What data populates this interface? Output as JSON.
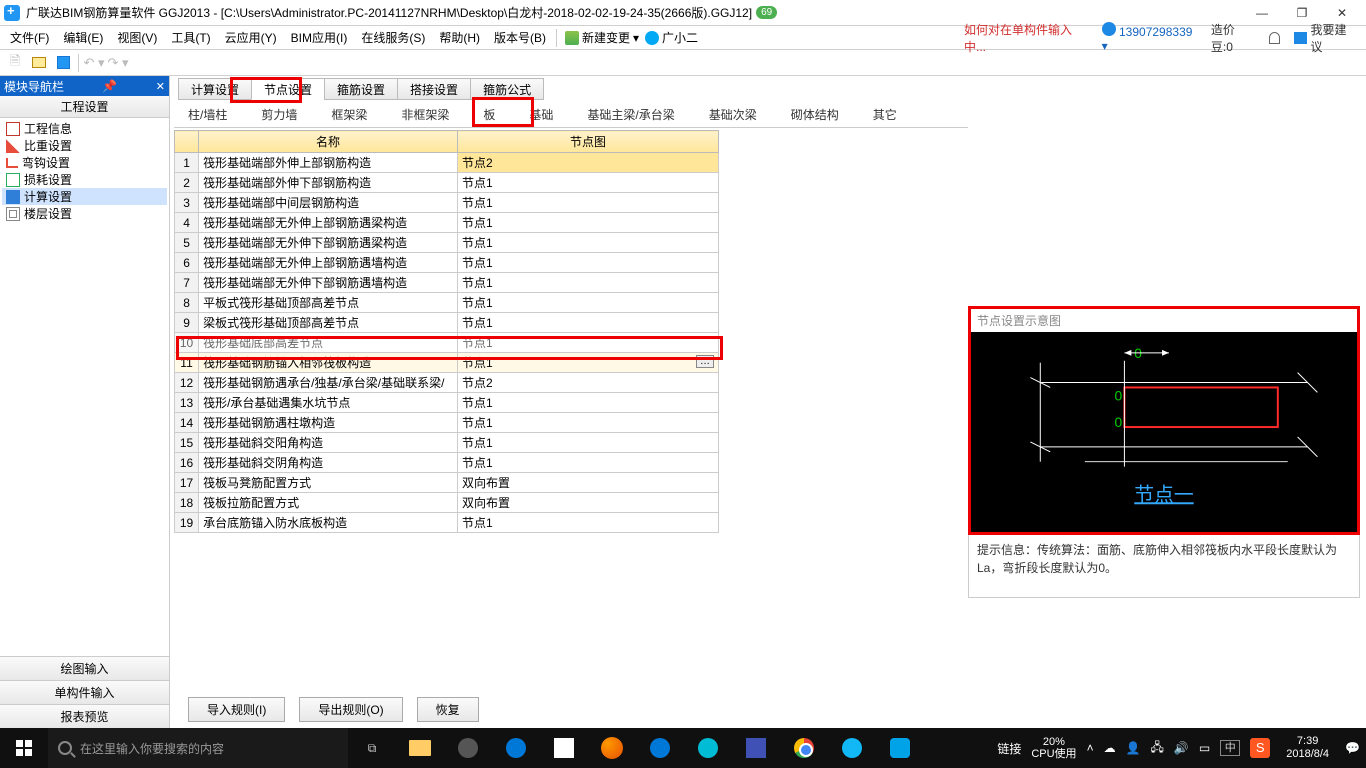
{
  "titlebar": {
    "app": "广联达BIM钢筋算量软件 GGJ2013",
    "doc": "[C:\\Users\\Administrator.PC-20141127NRHM\\Desktop\\白龙村-2018-02-02-19-24-35(2666版).GGJ12]",
    "tag": "69"
  },
  "menu": {
    "items": [
      "文件(F)",
      "编辑(E)",
      "视图(V)",
      "工具(T)",
      "云应用(Y)",
      "BIM应用(I)",
      "在线服务(S)",
      "帮助(H)",
      "版本号(B)"
    ],
    "newchange": "新建变更",
    "gxe": "广小二",
    "hint": "如何对在单构件输入中...",
    "user": "13907298339",
    "bean": "造价豆:0",
    "feedback": "我要建议"
  },
  "nav": {
    "header": "模块导航栏",
    "section": "工程设置",
    "tree": [
      "工程信息",
      "比重设置",
      "弯钩设置",
      "损耗设置",
      "计算设置",
      "楼层设置"
    ],
    "tree_selected_index": 4,
    "bottom": [
      "绘图输入",
      "单构件输入",
      "报表预览"
    ]
  },
  "tabs1": [
    "计算设置",
    "节点设置",
    "箍筋设置",
    "搭接设置",
    "箍筋公式"
  ],
  "tabs1_active": 1,
  "tabs2": [
    "柱/墙柱",
    "剪力墙",
    "框架梁",
    "非框架梁",
    "板",
    "基础",
    "基础主梁/承台梁",
    "基础次梁",
    "砌体结构",
    "其它"
  ],
  "tabs2_active": 5,
  "table": {
    "headers": [
      "",
      "名称",
      "节点图"
    ],
    "rows": [
      {
        "n": 1,
        "name": "筏形基础端部外伸上部钢筋构造",
        "node": "节点2",
        "hl": true
      },
      {
        "n": 2,
        "name": "筏形基础端部外伸下部钢筋构造",
        "node": "节点1"
      },
      {
        "n": 3,
        "name": "筏形基础端部中间层钢筋构造",
        "node": "节点1"
      },
      {
        "n": 4,
        "name": "筏形基础端部无外伸上部钢筋遇梁构造",
        "node": "节点1"
      },
      {
        "n": 5,
        "name": "筏形基础端部无外伸下部钢筋遇梁构造",
        "node": "节点1"
      },
      {
        "n": 6,
        "name": "筏形基础端部无外伸上部钢筋遇墙构造",
        "node": "节点1"
      },
      {
        "n": 7,
        "name": "筏形基础端部无外伸下部钢筋遇墙构造",
        "node": "节点1"
      },
      {
        "n": 8,
        "name": "平板式筏形基础顶部高差节点",
        "node": "节点1"
      },
      {
        "n": 9,
        "name": "梁板式筏形基础顶部高差节点",
        "node": "节点1"
      },
      {
        "n": 10,
        "name": "筏形基础底部高差节点",
        "node": "节点1",
        "cut": true
      },
      {
        "n": 11,
        "name": "筏形基础钢筋锚入相邻筏板构造",
        "node": "节点1",
        "sel": true
      },
      {
        "n": 12,
        "name": "筏形基础钢筋遇承台/独基/承台梁/基础联系梁/",
        "node": "节点2"
      },
      {
        "n": 13,
        "name": "筏形/承台基础遇集水坑节点",
        "node": "节点1"
      },
      {
        "n": 14,
        "name": "筏形基础钢筋遇柱墩构造",
        "node": "节点1"
      },
      {
        "n": 15,
        "name": "筏形基础斜交阳角构造",
        "node": "节点1"
      },
      {
        "n": 16,
        "name": "筏形基础斜交阴角构造",
        "node": "节点1"
      },
      {
        "n": 17,
        "name": "筏板马凳筋配置方式",
        "node": "双向布置"
      },
      {
        "n": 18,
        "name": "筏板拉筋配置方式",
        "node": "双向布置"
      },
      {
        "n": 19,
        "name": "承台底筋锚入防水底板构造",
        "node": "节点1"
      }
    ]
  },
  "actions": {
    "import": "导入规则(I)",
    "export": "导出规则(O)",
    "restore": "恢复"
  },
  "rightpanel": {
    "title": "节点设置示意图",
    "link": "节点一",
    "info_label": "提示信息：",
    "info_text": "传统算法：面筋、底筋伸入相邻筏板内水平段长度默认为La，弯折段长度默认为0。"
  },
  "taskbar": {
    "search_placeholder": "在这里输入你要搜索的内容",
    "link": "链接",
    "cpu_pct": "20%",
    "cpu_lbl": "CPU使用",
    "ime": "中",
    "time": "7:39",
    "date": "2018/8/4"
  }
}
